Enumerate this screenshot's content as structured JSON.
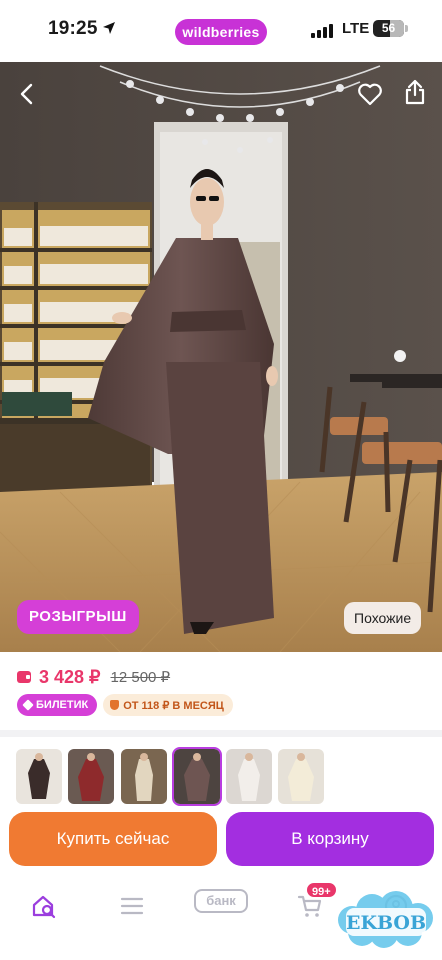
{
  "status_bar": {
    "time": "19:25",
    "network": "LTE",
    "battery": "56",
    "battery_level": 0.56
  },
  "header": {
    "brand": "wildberries"
  },
  "photo": {
    "giveaway_label": "РОЗЫГРЫШ",
    "similar_label": "Похожие"
  },
  "price": {
    "current": "3 428 ₽",
    "old": "12 500 ₽"
  },
  "tags": {
    "ticket": "БИЛЕТИК",
    "installment": "ОТ 118 ₽ В МЕСЯЦ"
  },
  "thumbnails": {
    "count": 6,
    "selected_index": 3
  },
  "actions": {
    "buy_now": "Купить сейчас",
    "add_to_cart": "В корзину"
  },
  "bottom_nav": {
    "bank_label": "банк",
    "cart_badge": "99+",
    "items": [
      "home-search-icon",
      "menu-icon",
      "bank-icon",
      "cart-icon",
      "profile-icon"
    ]
  },
  "watermark": {
    "text": "EKBOB"
  },
  "colors": {
    "brand_pink": "#c832d6",
    "price_red": "#e9366a",
    "buy_orange": "#f07a32",
    "cart_purple": "#a32ee0"
  }
}
